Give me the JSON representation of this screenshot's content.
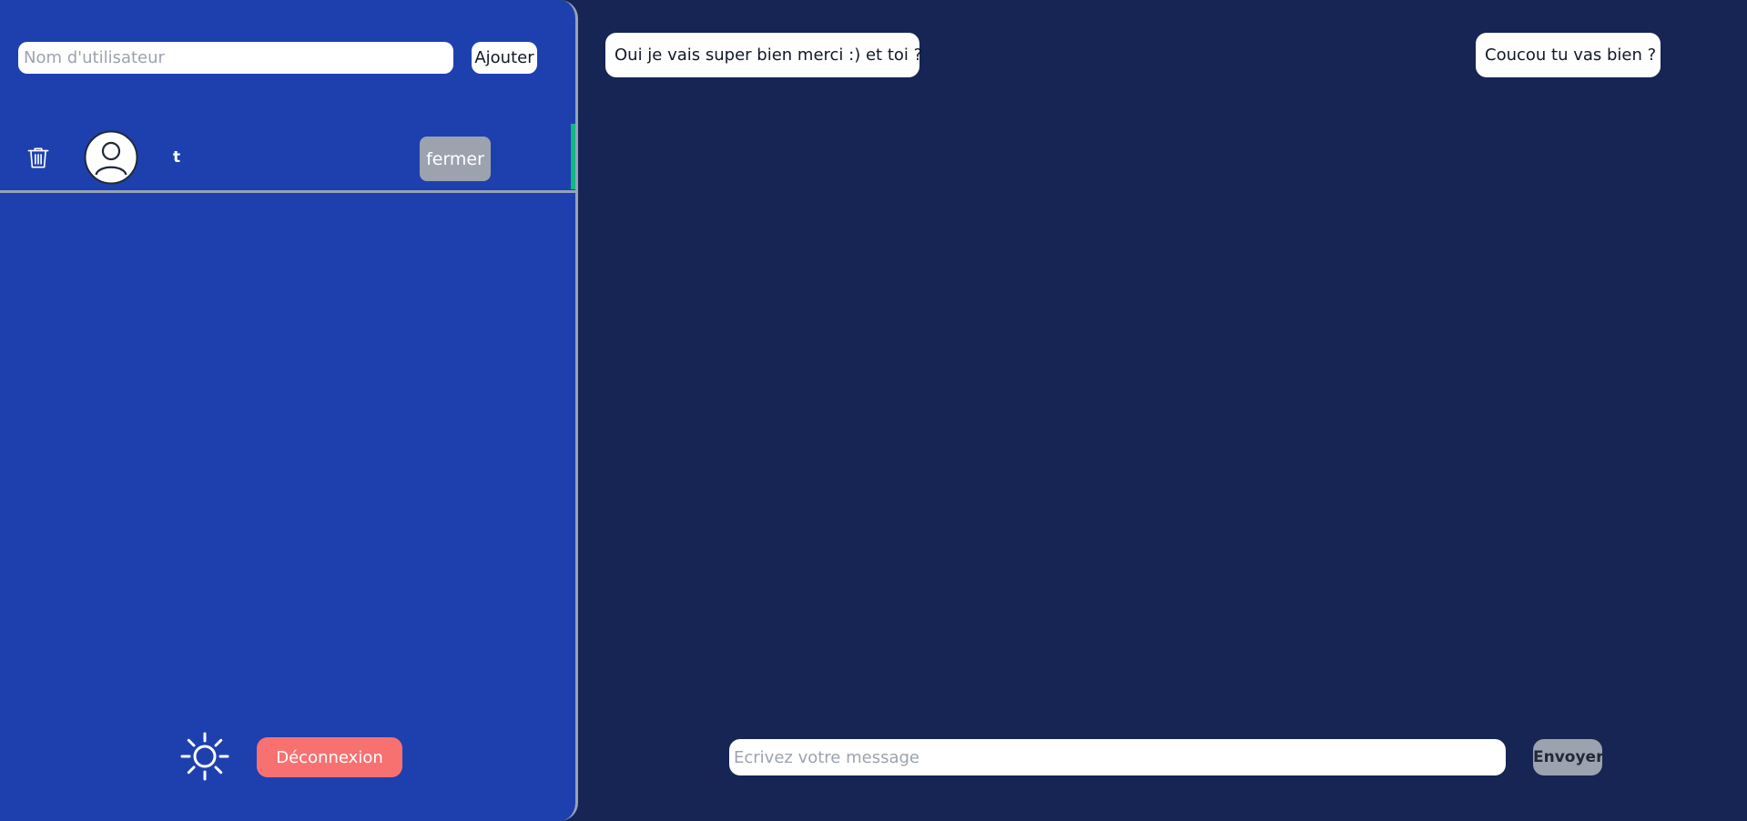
{
  "sidebar": {
    "add_user": {
      "placeholder": "Nom d'utilisateur",
      "value": "",
      "button_label": "Ajouter"
    },
    "contacts": [
      {
        "name": "t",
        "close_label": "fermer",
        "active": true,
        "icons": {
          "delete": "trash-icon",
          "avatar": "user-avatar-icon"
        }
      }
    ],
    "footer": {
      "theme_icon": "sun-icon",
      "logout_label": "Déconnexion"
    }
  },
  "chat": {
    "messages": [
      {
        "text": "Oui je vais super bien merci :) et toi ?",
        "side": "left"
      },
      {
        "text": "Coucou tu vas bien ?",
        "side": "right"
      }
    ],
    "composer": {
      "placeholder": "Ecrivez votre message",
      "value": "",
      "send_label": "Envoyer"
    }
  },
  "colors": {
    "sidebar_bg": "#1e40af",
    "chat_bg": "#172554",
    "active_indicator": "#10b981",
    "logout_button": "#f87171",
    "muted_button": "#9ca3af",
    "bubble_bg": "#ffffff"
  }
}
